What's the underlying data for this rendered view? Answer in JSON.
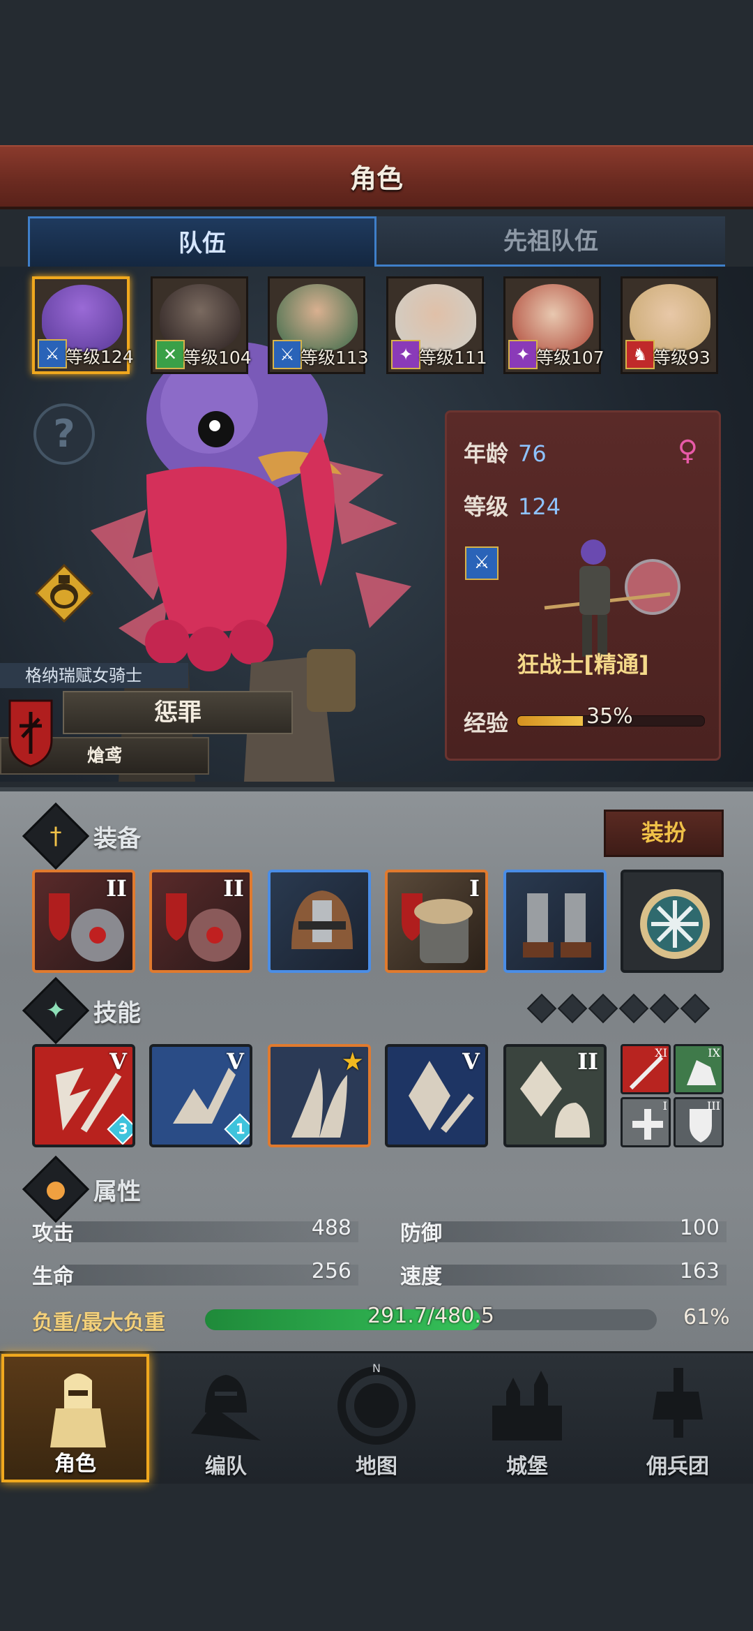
{
  "header": {
    "title": "角色"
  },
  "tabs": {
    "team": "队伍",
    "ancestor_team": "先祖队伍"
  },
  "roster": [
    {
      "level_text": "等级124",
      "class_color": "#2a63b8"
    },
    {
      "level_text": "等级104",
      "class_color": "#3aa048"
    },
    {
      "level_text": "等级113",
      "class_color": "#2a63b8"
    },
    {
      "level_text": "等级111",
      "class_color": "#8a3ab8"
    },
    {
      "level_text": "等级107",
      "class_color": "#8a3ab8"
    },
    {
      "level_text": "等级93",
      "class_color": "#c02a2a"
    }
  ],
  "hero": {
    "title": "格纳瑞赋女骑士",
    "name": "惩罪",
    "subtitle": "熗鸢"
  },
  "info": {
    "age_label": "年龄",
    "age_value": "76",
    "level_label": "等级",
    "level_value": "124",
    "gender_icon": "♀",
    "class_name": "狂战士[精通]",
    "exp_label": "经验",
    "exp_percent": "35%",
    "exp_fraction": 0.35
  },
  "equipment": {
    "label": "装备",
    "dress_button": "装扮",
    "slots": [
      {
        "tier": "II",
        "rarity": "orange",
        "icon": "axe-icon"
      },
      {
        "tier": "II",
        "rarity": "orange",
        "icon": "axe-icon"
      },
      {
        "tier": "",
        "rarity": "blue",
        "icon": "helmet-icon"
      },
      {
        "tier": "I",
        "rarity": "orange",
        "icon": "armor-icon"
      },
      {
        "tier": "",
        "rarity": "blue",
        "icon": "boots-icon"
      },
      {
        "tier": "",
        "rarity": "dark",
        "icon": "amulet-icon"
      }
    ]
  },
  "skills": {
    "label": "技能",
    "items": [
      {
        "tier": "V",
        "gem": "3",
        "bg": "#b8221e",
        "icon": "slash-icon"
      },
      {
        "tier": "V",
        "gem": "1",
        "bg": "#2a4c86",
        "icon": "leap-icon"
      },
      {
        "tier": "★",
        "gem": "",
        "bg": "#2b3a56",
        "icon": "claw-icon"
      },
      {
        "tier": "V",
        "gem": "",
        "bg": "#1e3564",
        "icon": "crystal-icon"
      },
      {
        "tier": "II",
        "gem": "",
        "bg": "#3a443e",
        "icon": "crystal-hand-icon"
      }
    ],
    "minis": [
      {
        "tier": "XI",
        "bg": "#b82420",
        "icon": "sword-icon"
      },
      {
        "tier": "IX",
        "bg": "#3f7a4a",
        "icon": "fist-icon"
      },
      {
        "tier": "I",
        "bg": "#6a6f72",
        "icon": "cross-icon"
      },
      {
        "tier": "III",
        "bg": "#5a6064",
        "icon": "shield-icon"
      }
    ]
  },
  "attributes": {
    "label": "属性",
    "attack_label": "攻击",
    "attack_value": "488",
    "defense_label": "防御",
    "defense_value": "100",
    "hp_label": "生命",
    "hp_value": "256",
    "speed_label": "速度",
    "speed_value": "163",
    "load_label": "负重/最大负重",
    "load_value": "291.7/480.5",
    "load_percent": "61%",
    "load_fraction": 0.61
  },
  "nav": {
    "character": "角色",
    "formation": "编队",
    "map": "地图",
    "castle": "城堡",
    "mercenary": "佣兵团"
  }
}
